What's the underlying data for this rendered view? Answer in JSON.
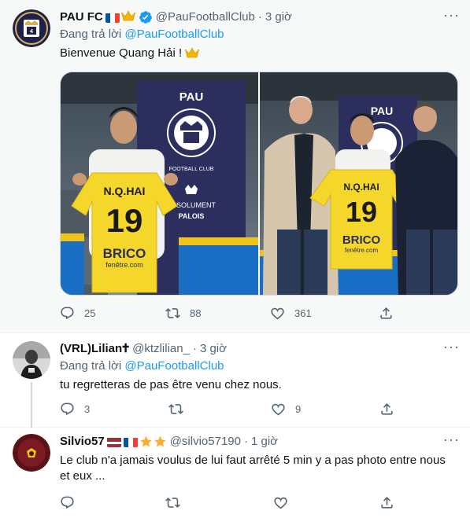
{
  "main": {
    "name": "PAU FC",
    "handle": "@PauFootballClub",
    "time": "3 giờ",
    "replying_prefix": "Đang trả lời",
    "replying_to": "@PauFootballClub",
    "text": "Bienvenue Quang Hải !",
    "photo1": {
      "jersey_name": "N.Q.HAI",
      "jersey_number": "19",
      "banner_top": "PAU",
      "banner_club": "FOOTBALL CLUB",
      "banner_tagline_1": "ABSOLUMENT",
      "banner_tagline_2": "PALOIS",
      "sponsor": "BRICO",
      "sponsor_sub": "fenêtre.com"
    },
    "photo2": {
      "jersey_name": "N.Q.HAI",
      "jersey_number": "19",
      "banner_top": "PAU",
      "sponsor": "BRICO",
      "sponsor_sub": "fenêtre.com"
    },
    "counts": {
      "replies": "25",
      "retweets": "88",
      "likes": "361"
    }
  },
  "reply1": {
    "name": "(VRL)Lilian🕇",
    "handle": "@ktzlilian_",
    "time": "3 giờ",
    "replying_prefix": "Đang trả lời",
    "replying_to": "@PauFootballClub",
    "text": "tu regretteras de pas être venu chez nous.",
    "counts": {
      "replies": "3",
      "retweets": "",
      "likes": "9"
    }
  },
  "reply2": {
    "name": "Silvio57",
    "handle": "@silvio57190",
    "time": "1 giờ",
    "text": "Le club n'a jamais voulus de lui faut arrêté 5 min y a pas photo entre nous et eux ...",
    "counts": {
      "replies": "",
      "retweets": "",
      "likes": ""
    }
  },
  "separator": "·",
  "colors": {
    "accent": "#1d9bf0",
    "secondary_text": "#536471",
    "jersey_yellow": "#f5d62b",
    "banner_navy": "#2c2f5e"
  },
  "icons": [
    "more-icon",
    "reply-icon",
    "retweet-icon",
    "like-icon",
    "share-icon",
    "verified-icon",
    "crown-icon",
    "star-icon"
  ]
}
